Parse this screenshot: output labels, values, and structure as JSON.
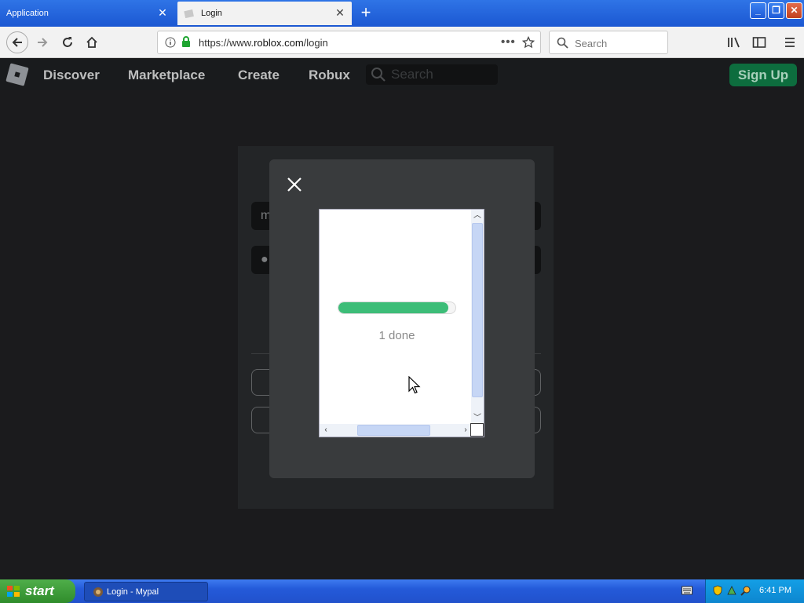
{
  "browser": {
    "tabs": [
      {
        "label": "Application",
        "active": false
      },
      {
        "label": "Login",
        "active": true
      }
    ],
    "new_tab_icon": "plus-icon",
    "url": {
      "prefix": "https://www.",
      "host": "roblox.com",
      "path": "/login"
    },
    "search_placeholder": "Search"
  },
  "site": {
    "nav": [
      "Discover",
      "Marketplace",
      "Create",
      "Robux"
    ],
    "search_placeholder": "Search",
    "signup_label": "Sign Up",
    "username_partial": "m",
    "password_partial": "●"
  },
  "modal": {
    "progress_fraction": 0.94,
    "progress_color": "#3dbd78",
    "progress_label": "1 done"
  },
  "taskbar": {
    "start_label": "start",
    "task_label": "Login - Mypal",
    "clock": "6:41 PM"
  }
}
